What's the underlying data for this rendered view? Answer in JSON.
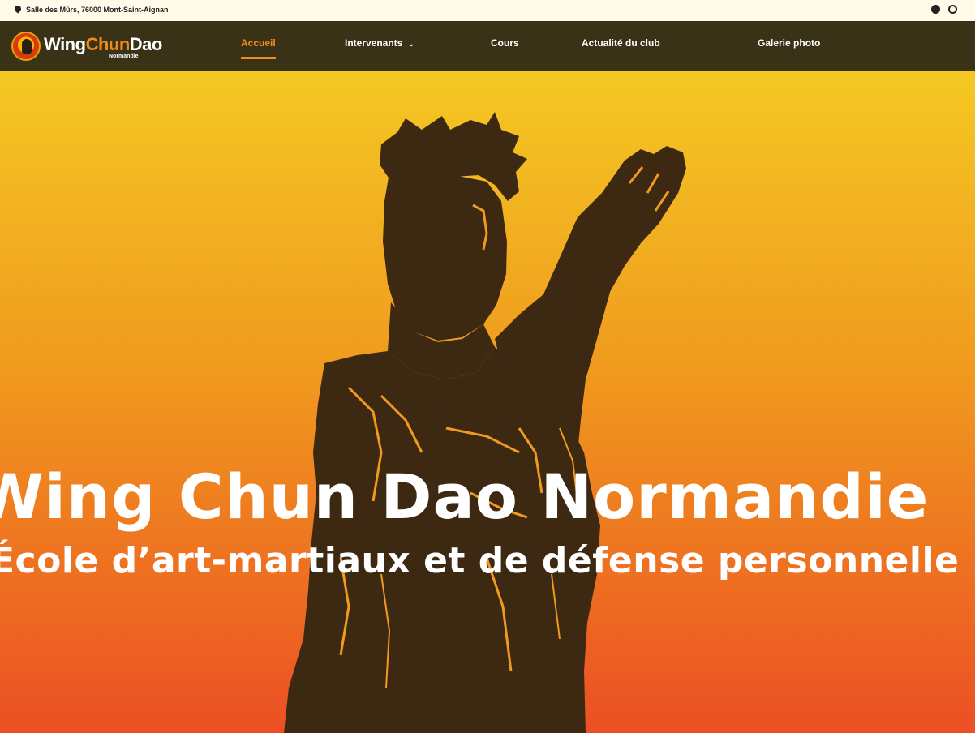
{
  "topbar": {
    "address": "Salle des Mûrs, 76000 Mont-Saint-Aignan"
  },
  "logo": {
    "part1": "Wing",
    "part2": "Chun",
    "part3": "Dao",
    "sub": "Normandie"
  },
  "nav": {
    "items": [
      {
        "label": "Accueil",
        "active": true
      },
      {
        "label": "Intervenants",
        "has_dropdown": true
      },
      {
        "label": "Cours"
      },
      {
        "label": "Actualité du club"
      },
      {
        "label": "Galerie photo"
      }
    ],
    "dropdown_caret": "⌄"
  },
  "hero": {
    "title": "Wing Chun Dao Normandie",
    "subtitle": "École d’art-martiaux et de défense personnelle"
  },
  "colors": {
    "accent": "#f28a1a",
    "nav_bg": "#3a3217",
    "silhouette": "#3d2912",
    "gradient_top": "#f4c823",
    "gradient_bottom": "#ec4f24"
  },
  "icons": {
    "address": "map-pin-icon",
    "social1": "facebook-icon",
    "social2": "instagram-icon",
    "logo": "logo-emblem-icon"
  }
}
